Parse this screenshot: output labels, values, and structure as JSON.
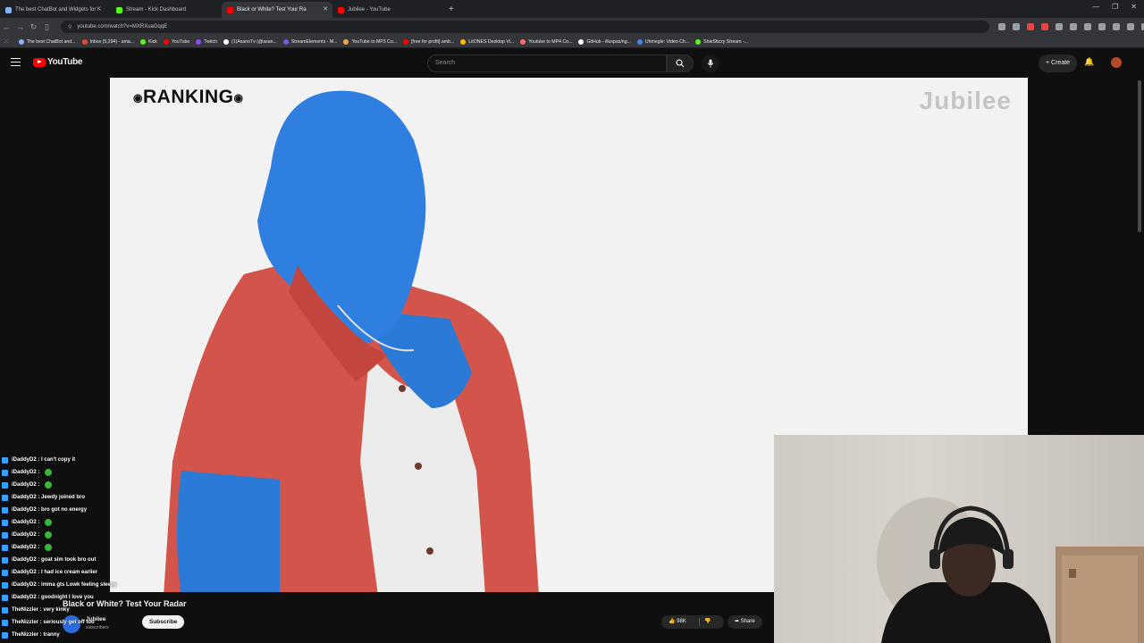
{
  "browser": {
    "tabs": [
      {
        "label": "The best ChatBot and Widgets for K",
        "color": "#8ab4f8",
        "active": false
      },
      {
        "label": "Stream - Kick Dashboard",
        "color": "#53fc18",
        "active": false
      },
      {
        "label": "Black or White? Test Your Ra",
        "color": "#ff0000",
        "active": true
      },
      {
        "label": "Jubilee - YouTube",
        "color": "#ff0000",
        "active": false
      }
    ],
    "url": "youtube.com/watch?v=MXRXuaGqqE",
    "bookmarks": [
      {
        "label": "The best ChatBot and...",
        "color": "#8ab4f8"
      },
      {
        "label": "Inbox (5,294) - ama...",
        "color": "#ea4335"
      },
      {
        "label": "Kick",
        "color": "#53fc18"
      },
      {
        "label": "YouTube",
        "color": "#ff0000"
      },
      {
        "label": "Twitch",
        "color": "#9146ff"
      },
      {
        "label": "(1)AsanoTv (@asan...",
        "color": "#ffffff"
      },
      {
        "label": "StreamElements - M...",
        "color": "#6c5ce7"
      },
      {
        "label": "YouTube to MP3 Co...",
        "color": "#f4a742"
      },
      {
        "label": "[free for profit] amb...",
        "color": "#ff0000"
      },
      {
        "label": "LitONES Desktop Vi...",
        "color": "#fbbc04"
      },
      {
        "label": "Youtube to MP4 Co...",
        "color": "#ff6b6b"
      },
      {
        "label": "GitHub - illuspas/ng...",
        "color": "#ffffff"
      },
      {
        "label": "Uhmegle: Video Ch...",
        "color": "#4285f4"
      },
      {
        "label": "ShieStizzy Stream -...",
        "color": "#53fc18"
      }
    ]
  },
  "youtube": {
    "logo_text": "YouTube",
    "search_placeholder": "Search",
    "create_label": "Create"
  },
  "video": {
    "overlay_title": "RANKING",
    "watermark": "Jubilee",
    "title": "Black or White? Test Your Radar",
    "channel": "Jubilee",
    "subscribers": "subscribers",
    "subscribe_label": "Subscribe",
    "likes": "98K",
    "share_label": "Share"
  },
  "chat": [
    {
      "user": "iDaddyD2",
      "message": "I can't copy it",
      "emote": false
    },
    {
      "user": "iDaddyD2",
      "message": "",
      "emote": true
    },
    {
      "user": "iDaddyD2",
      "message": "",
      "emote": true
    },
    {
      "user": "iDaddyD2",
      "message": "Jewdy joined bro",
      "emote": false
    },
    {
      "user": "iDaddyD2",
      "message": "bro got no energy",
      "emote": false
    },
    {
      "user": "iDaddyD2",
      "message": "",
      "emote": true
    },
    {
      "user": "iDaddyD2",
      "message": "",
      "emote": true
    },
    {
      "user": "iDaddyD2",
      "message": "",
      "emote": true
    },
    {
      "user": "iDaddyD2",
      "message": "goat sim took bro out",
      "emote": false
    },
    {
      "user": "iDaddyD2",
      "message": "I had ice cream earlier",
      "emote": false
    },
    {
      "user": "iDaddyD2",
      "message": "imma gts Lowk feeling sleepy",
      "emote": false
    },
    {
      "user": "iDaddyD2",
      "message": "goodnight I love you",
      "emote": false
    },
    {
      "user": "TheNizzler",
      "message": "very kinky",
      "emote": false
    },
    {
      "user": "TheNizzler",
      "message": "seriously get off too",
      "emote": false
    },
    {
      "user": "TheNizzler",
      "message": "tranny",
      "emote": false
    }
  ]
}
